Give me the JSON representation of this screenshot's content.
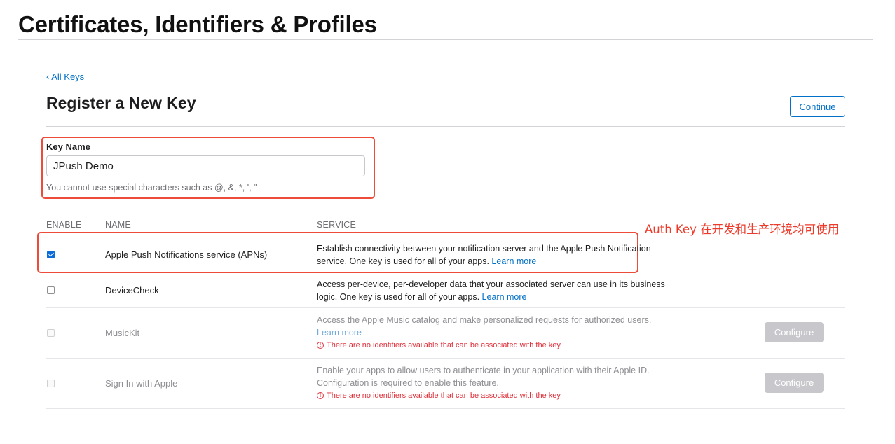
{
  "header": {
    "title": "Certificates, Identifiers & Profiles"
  },
  "nav": {
    "back_label": "‹ All Keys"
  },
  "section": {
    "title": "Register a New Key",
    "continue_label": "Continue"
  },
  "key_name": {
    "label": "Key Name",
    "value": "JPush Demo",
    "hint": "You cannot use special characters such as @, &, *, ', \""
  },
  "annotation": {
    "text": "Auth Key 在开发和生产环境均可使用",
    "color": "#ee3a2a"
  },
  "table": {
    "headers": {
      "enable": "ENABLE",
      "name": "NAME",
      "service": "SERVICE"
    },
    "rows": [
      {
        "name": "Apple Push Notifications service (APNs)",
        "checked": true,
        "enabled": true,
        "desc": "Establish connectivity between your notification server and the Apple Push Notification service. One key is used for all of your apps. ",
        "learn_more": "Learn more"
      },
      {
        "name": "DeviceCheck",
        "checked": false,
        "enabled": true,
        "desc": "Access per-device, per-developer data that your associated server can use in its business logic. One key is used for all of your apps. ",
        "learn_more": "Learn more"
      },
      {
        "name": "MusicKit",
        "checked": false,
        "enabled": false,
        "desc": "Access the Apple Music catalog and make personalized requests for authorized users. ",
        "learn_more": "Learn more",
        "warning": "There are no identifiers available that can be associated with the key",
        "configure_label": "Configure"
      },
      {
        "name": "Sign In with Apple",
        "checked": false,
        "enabled": false,
        "desc": "Enable your apps to allow users to authenticate in your application with their Apple ID. Configuration is required to enable this feature.",
        "warning": "There are no identifiers available that can be associated with the key",
        "configure_label": "Configure"
      }
    ]
  },
  "colors": {
    "accent": "#0070c9",
    "highlight_border": "#ee4c3a",
    "warning": "#e0303a",
    "checkbox_checked": "#0a6cd8"
  },
  "icons": {
    "warning": "exclamation-circle-icon",
    "checkbox": "checkbox-icon"
  }
}
